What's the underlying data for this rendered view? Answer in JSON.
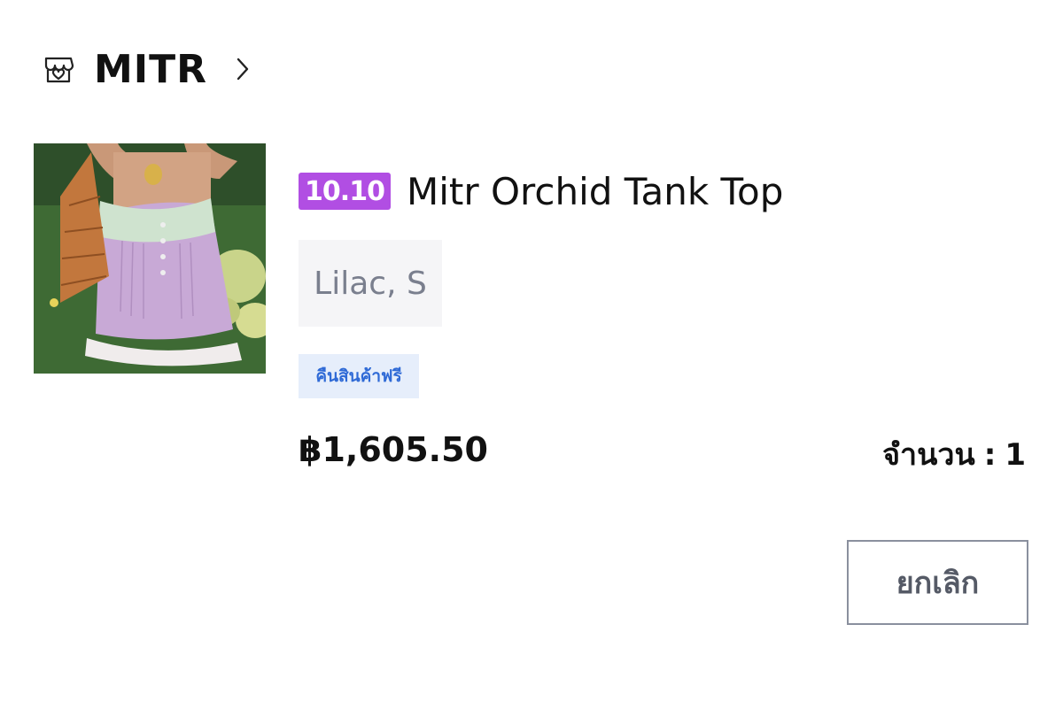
{
  "shop": {
    "icon": "shop-icon",
    "name": "MITR",
    "chevron_icon": "chevron-right-icon"
  },
  "product": {
    "image_alt": "Lilac lace tank top photo",
    "promo_badge": "10.10",
    "promo_color": "#b14ee3",
    "title": "Mitr Orchid Tank Top",
    "variant": "Lilac, S",
    "return_tag": "คืนสินค้าฟรี",
    "return_tag_color": "#2f6ad6",
    "price": "฿1,605.50",
    "quantity_label": "จำนวน",
    "quantity_separator": ":",
    "quantity_value": "1"
  },
  "actions": {
    "cancel_label": "ยกเลิก"
  }
}
